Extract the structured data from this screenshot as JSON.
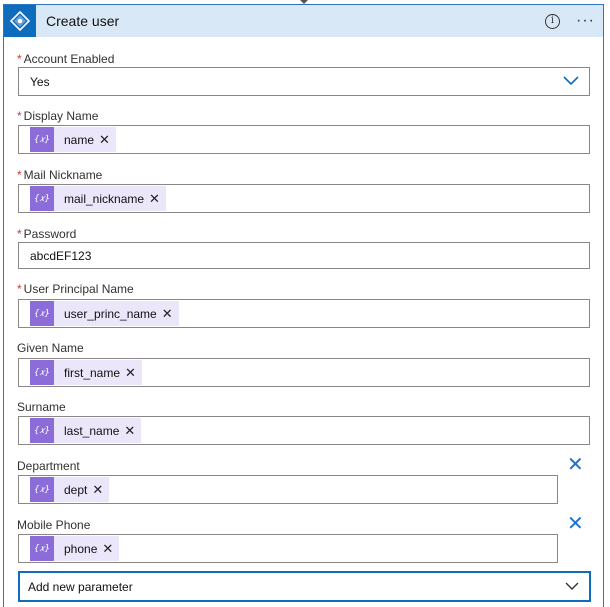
{
  "header": {
    "title": "Create user",
    "info_icon": "info-icon",
    "more_icon": "more-icon",
    "more_glyph": "···",
    "info_glyph": "i"
  },
  "token_icon_glyph": "{𝑥}",
  "remove_glyph": "✕",
  "fields": {
    "account_enabled": {
      "label": "Account Enabled",
      "required": true,
      "value": "Yes"
    },
    "display_name": {
      "label": "Display Name",
      "required": true,
      "token": "name"
    },
    "mail_nickname": {
      "label": "Mail Nickname",
      "required": true,
      "token": "mail_nickname"
    },
    "password": {
      "label": "Password",
      "required": true,
      "value": "abcdEF123"
    },
    "user_principal_name": {
      "label": "User Principal Name",
      "required": true,
      "token": "user_princ_name"
    },
    "given_name": {
      "label": "Given Name",
      "required": false,
      "token": "first_name"
    },
    "surname": {
      "label": "Surname",
      "required": false,
      "token": "last_name"
    },
    "department": {
      "label": "Department",
      "required": false,
      "token": "dept"
    },
    "mobile_phone": {
      "label": "Mobile Phone",
      "required": false,
      "token": "phone"
    }
  },
  "required_marker": "*",
  "add_parameter": {
    "label": "Add new parameter"
  },
  "colors": {
    "header_bg": "#d9e8f6",
    "accent": "#0f6cbd",
    "token_bg": "#ece6fa",
    "token_icon_bg": "#8c6cd9",
    "required": "#d13438"
  }
}
